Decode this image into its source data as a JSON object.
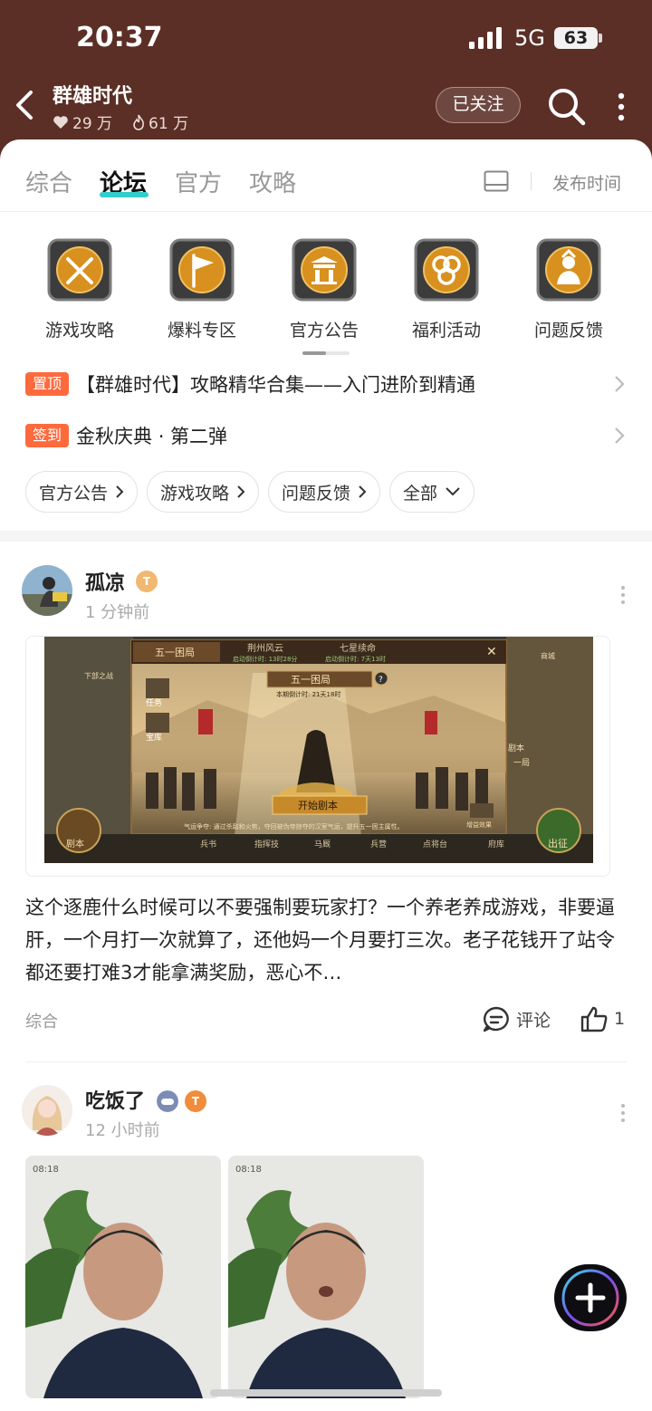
{
  "status_bar": {
    "time": "20:37",
    "network": "5G",
    "battery": "63"
  },
  "header": {
    "title": "群雄时代",
    "likes": "29 万",
    "hot": "61 万",
    "follow_label": "已关注"
  },
  "tabs": [
    {
      "label": "综合",
      "active": false
    },
    {
      "label": "论坛",
      "active": true
    },
    {
      "label": "官方",
      "active": false
    },
    {
      "label": "攻略",
      "active": false
    }
  ],
  "sort_label": "发布时间",
  "categories": [
    {
      "label": "游戏攻略",
      "icon": "crossed-swords-icon"
    },
    {
      "label": "爆料专区",
      "icon": "flag-icon"
    },
    {
      "label": "官方公告",
      "icon": "gate-icon"
    },
    {
      "label": "福利活动",
      "icon": "coins-icon"
    },
    {
      "label": "问题反馈",
      "icon": "warrior-icon"
    }
  ],
  "pinned": [
    {
      "tag": "置顶",
      "text": "【群雄时代】攻略精华合集——入门进阶到精通"
    },
    {
      "tag": "签到",
      "text": "金秋庆典 · 第二弹"
    }
  ],
  "filters": [
    {
      "label": "官方公告",
      "icon": "chevron-right-icon"
    },
    {
      "label": "游戏攻略",
      "icon": "chevron-right-icon"
    },
    {
      "label": "问题反馈",
      "icon": "chevron-right-icon"
    },
    {
      "label": "全部",
      "icon": "chevron-down-icon"
    }
  ],
  "posts": [
    {
      "user": "孤凉",
      "time": "1 分钟前",
      "image": {
        "tabs": [
          "五一困局",
          "荆州风云",
          "七星续命"
        ],
        "timers": [
          "启动倒计时: 13时28分",
          "启动倒计时: 7天13时"
        ],
        "banner": "五一困局",
        "countdown": "本期倒计时: 21天18时",
        "start_button": "开始剧本",
        "desc": "气运争夺: 通过杀敌和火势，夺回被伪帝掠夺的汉室气运，提升五一困主属性。",
        "side_left": [
          "任务",
          "宝库"
        ],
        "side_right": [
          "商城",
          "剧本",
          "一局"
        ],
        "side_top_left": "下部之战",
        "bonus": "增益效果",
        "bottom_menu": [
          "兵书",
          "指挥技",
          "马厩",
          "兵营",
          "点将台",
          "府库"
        ],
        "left_button": "剧本",
        "right_button": "出征"
      },
      "text": "这个逐鹿什么时候可以不要强制要玩家打？一个养老养成游戏，非要逼肝，一个月打一次就算了，还他妈一个月要打三次。老子花钱开了站令都还要打难3才能拿满奖励，恶心不…",
      "category": "综合",
      "comment_label": "评论",
      "like_count": "1"
    },
    {
      "user": "吃饭了",
      "time": "12 小时前",
      "photo_time": "08:18"
    }
  ]
}
